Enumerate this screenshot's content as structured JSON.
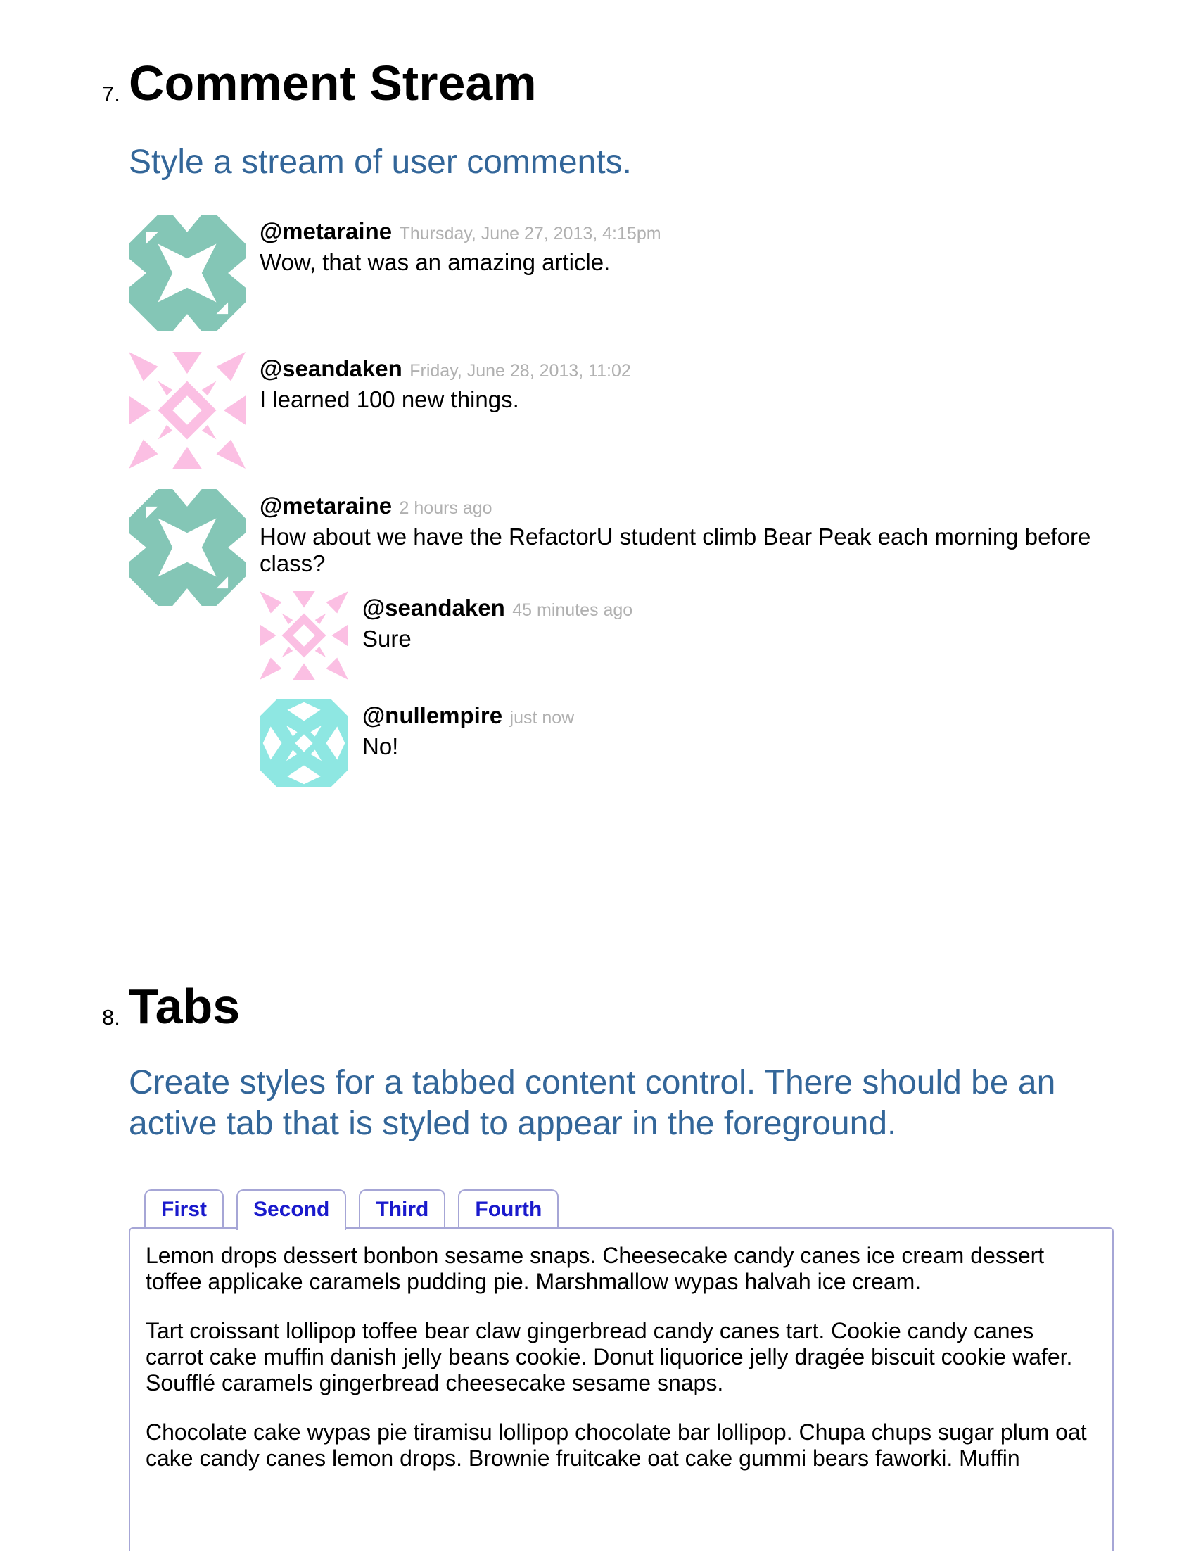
{
  "sections": {
    "comments": {
      "number": "7.",
      "title": "Comment Stream",
      "subtitle": "Style a stream of user comments.",
      "items": [
        {
          "user": "@metaraine",
          "time": "Thursday, June 27, 2013, 4:15pm",
          "text": "Wow, that was an amazing article.",
          "avatar": "teal-identicon"
        },
        {
          "user": "@seandaken",
          "time": "Friday, June 28, 2013, 11:02",
          "text": "I learned 100 new things.",
          "avatar": "pink-identicon"
        },
        {
          "user": "@metaraine",
          "time": "2 hours ago",
          "text": "How about we have the RefactorU student climb Bear Peak each morning before class?",
          "avatar": "teal-identicon"
        },
        {
          "user": "@seandaken",
          "time": "45 minutes ago",
          "text": "Sure",
          "avatar": "pink-identicon"
        },
        {
          "user": "@nullempire",
          "time": "just now",
          "text": "No!",
          "avatar": "aqua-identicon"
        }
      ]
    },
    "tabs": {
      "number": "8.",
      "title": "Tabs",
      "subtitle": "Create styles for a tabbed content control. There should be an active tab that is styled to appear in the foreground.",
      "tabs": [
        "First",
        "Second",
        "Third",
        "Fourth"
      ],
      "active_tab": "Second",
      "paragraphs": [
        "Lemon drops dessert bonbon sesame snaps. Cheesecake candy canes ice cream dessert toffee applicake caramels pudding pie. Marshmallow wypas halvah ice cream.",
        "Tart croissant lollipop toffee bear claw gingerbread candy canes tart. Cookie candy canes carrot cake muffin danish jelly beans cookie. Donut liquorice jelly dragée biscuit cookie wafer. Soufflé caramels gingerbread cheesecake sesame snaps.",
        "Chocolate cake wypas pie tiramisu lollipop chocolate bar lollipop. Chupa chups sugar plum oat cake candy canes lemon drops. Brownie fruitcake oat cake gummi bears faworki. Muffin"
      ]
    }
  },
  "colors": {
    "subtitle": "#336699",
    "timestamp": "#b0b0b0",
    "tab_text": "#1a1acc",
    "tab_border": "#a6a6d6",
    "teal": "#84c6b6",
    "pink": "#fbbfe3",
    "aqua": "#8ee7e2"
  }
}
